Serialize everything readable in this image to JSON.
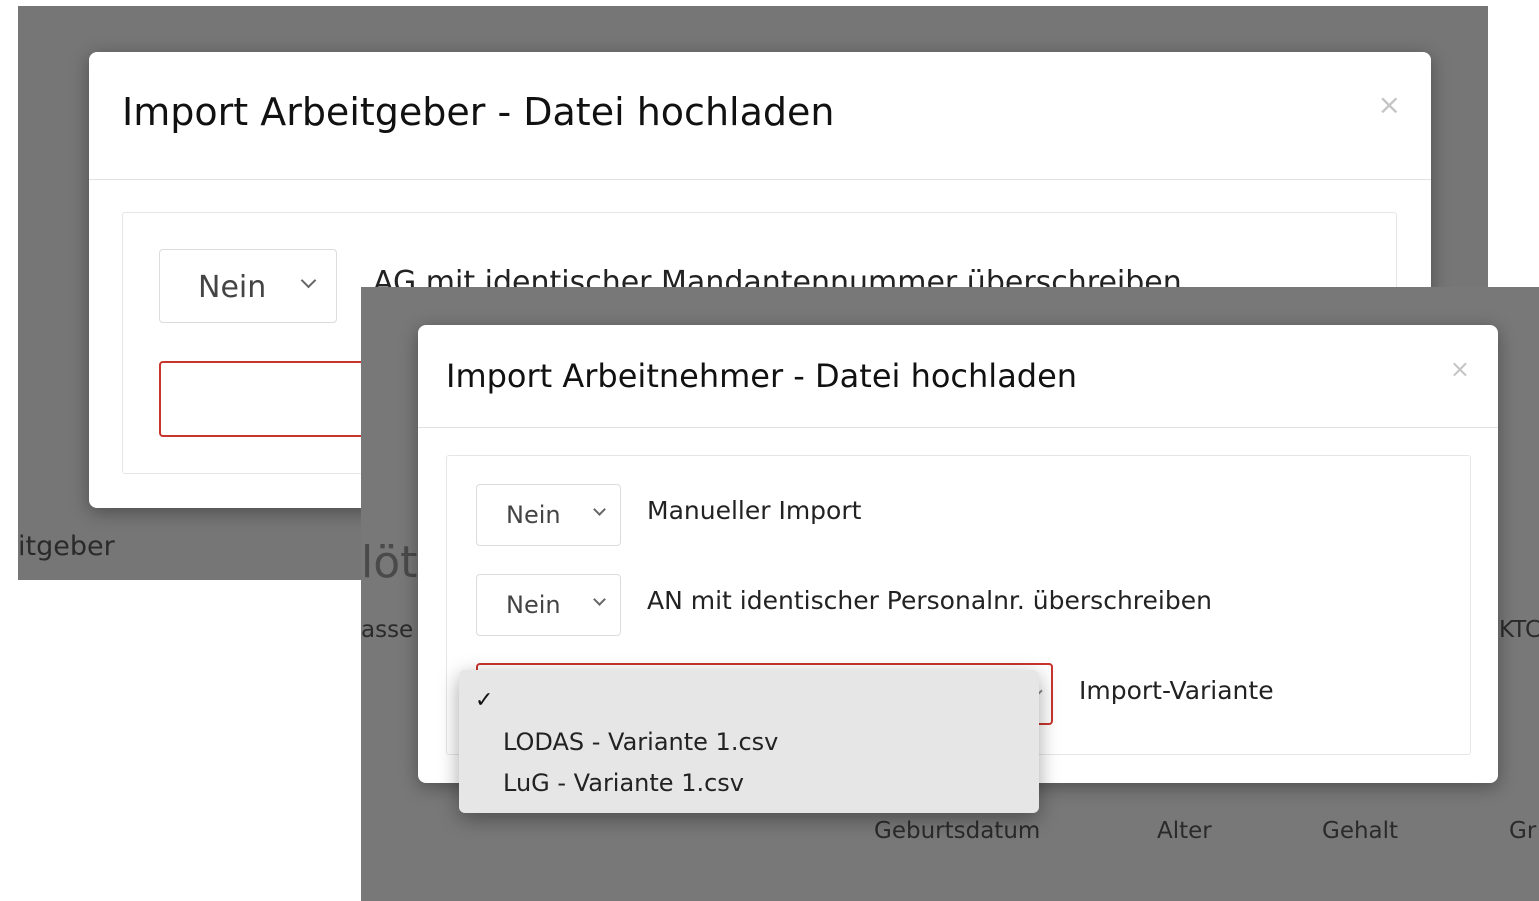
{
  "employer_dialog": {
    "title": "Import Arbeitgeber - Datei hochladen",
    "close_symbol": "×",
    "overwrite_select": {
      "value": "Nein"
    },
    "overwrite_label": "AG mit identischer Mandantennummer überschreiben",
    "background_fragments": {
      "left_text": "itgeber"
    }
  },
  "employee_dialog": {
    "title": "Import Arbeitnehmer - Datei hochladen",
    "close_symbol": "×",
    "manual_import": {
      "value": "Nein",
      "label": "Manueller Import"
    },
    "overwrite": {
      "value": "Nein",
      "label": "AN mit identischer Personalnr. überschreiben"
    },
    "variant": {
      "label": "Import-Variante",
      "checkmark": "✓",
      "options": [
        "LODAS - Variante 1.csv",
        "LuG - Variante 1.csv"
      ]
    },
    "background_fragments": {
      "top_left": "löt",
      "left_col": "asse",
      "right_col": "KTC",
      "table_headers": [
        "Geburtsdatum",
        "Alter",
        "Gehalt",
        "Gr"
      ]
    }
  }
}
